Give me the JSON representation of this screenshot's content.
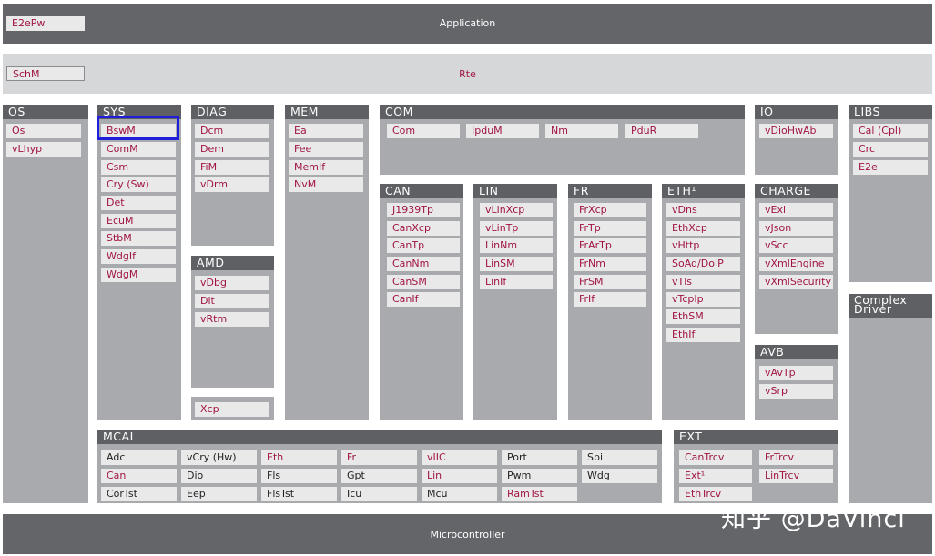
{
  "application": {
    "label": "Application",
    "e2epw": "E2ePw"
  },
  "rte": {
    "label": "Rte",
    "schm": "SchM"
  },
  "microcontroller": {
    "label": "Microcontroller"
  },
  "watermark": "知乎 @DaVinci",
  "os": {
    "title": "OS",
    "items": [
      "Os",
      "vLhyp"
    ]
  },
  "sys": {
    "title": "SYS",
    "items": [
      "BswM",
      "ComM",
      "Csm",
      "Cry (Sw)",
      "Det",
      "EcuM",
      "StbM",
      "WdgIf",
      "WdgM"
    ]
  },
  "diag": {
    "title": "DIAG",
    "items": [
      "Dcm",
      "Dem",
      "FiM",
      "vDrm"
    ]
  },
  "amd": {
    "title": "AMD",
    "items": [
      "vDbg",
      "Dlt",
      "vRtm"
    ]
  },
  "xcp": {
    "items": [
      "Xcp"
    ]
  },
  "mem": {
    "title": "MEM",
    "items": [
      "Ea",
      "Fee",
      "MemIf",
      "NvM"
    ]
  },
  "com": {
    "title": "COM",
    "items": [
      "Com",
      "IpduM",
      "Nm",
      "PduR"
    ]
  },
  "can": {
    "title": "CAN",
    "items": [
      "J1939Tp",
      "CanXcp",
      "CanTp",
      "CanNm",
      "CanSM",
      "CanIf"
    ]
  },
  "lin": {
    "title": "LIN",
    "items": [
      "vLinXcp",
      "vLinTp",
      "LinNm",
      "LinSM",
      "LinIf"
    ]
  },
  "fr": {
    "title": "FR",
    "items": [
      "FrXcp",
      "FrTp",
      "FrArTp",
      "FrNm",
      "FrSM",
      "FrIf"
    ]
  },
  "eth": {
    "title": "ETH¹",
    "items": [
      "vDns",
      "EthXcp",
      "vHttp",
      "SoAd/DoIP",
      "vTls",
      "vTcpIp",
      "EthSM",
      "EthIf"
    ]
  },
  "io": {
    "title": "IO",
    "items": [
      "vDioHwAb"
    ]
  },
  "charge": {
    "title": "CHARGE",
    "items": [
      "vExi",
      "vJson",
      "vScc",
      "vXmlEngine",
      "vXmlSecurity"
    ]
  },
  "avb": {
    "title": "AVB",
    "items": [
      "vAvTp",
      "vSrp"
    ]
  },
  "libs": {
    "title": "LIBS",
    "items": [
      "Cal (Cpl)",
      "Crc",
      "E2e"
    ]
  },
  "complex": {
    "title": "Complex Driver"
  },
  "mcal": {
    "title": "MCAL",
    "items": [
      "Adc",
      "vCry (Hw)",
      "Eth",
      "Fr",
      "vIIC",
      "Port",
      "Spi",
      "Can",
      "Dio",
      "Fls",
      "Gpt",
      "Lin",
      "Pwm",
      "Wdg",
      "CorTst",
      "Eep",
      "FlsTst",
      "Icu",
      "Mcu",
      "RamTst"
    ],
    "highlighted": [
      "Eth",
      "Fr",
      "vIIC",
      "Can",
      "Lin",
      "RamTst"
    ]
  },
  "ext": {
    "title": "EXT",
    "items": [
      "CanTrcv",
      "FrTrcv",
      "Ext¹",
      "LinTrcv",
      "EthTrcv"
    ]
  },
  "colors": {
    "module_text": "#a01541",
    "panel": "#a8aaad",
    "header": "#5e6064",
    "selection": "#1f1fdb"
  }
}
